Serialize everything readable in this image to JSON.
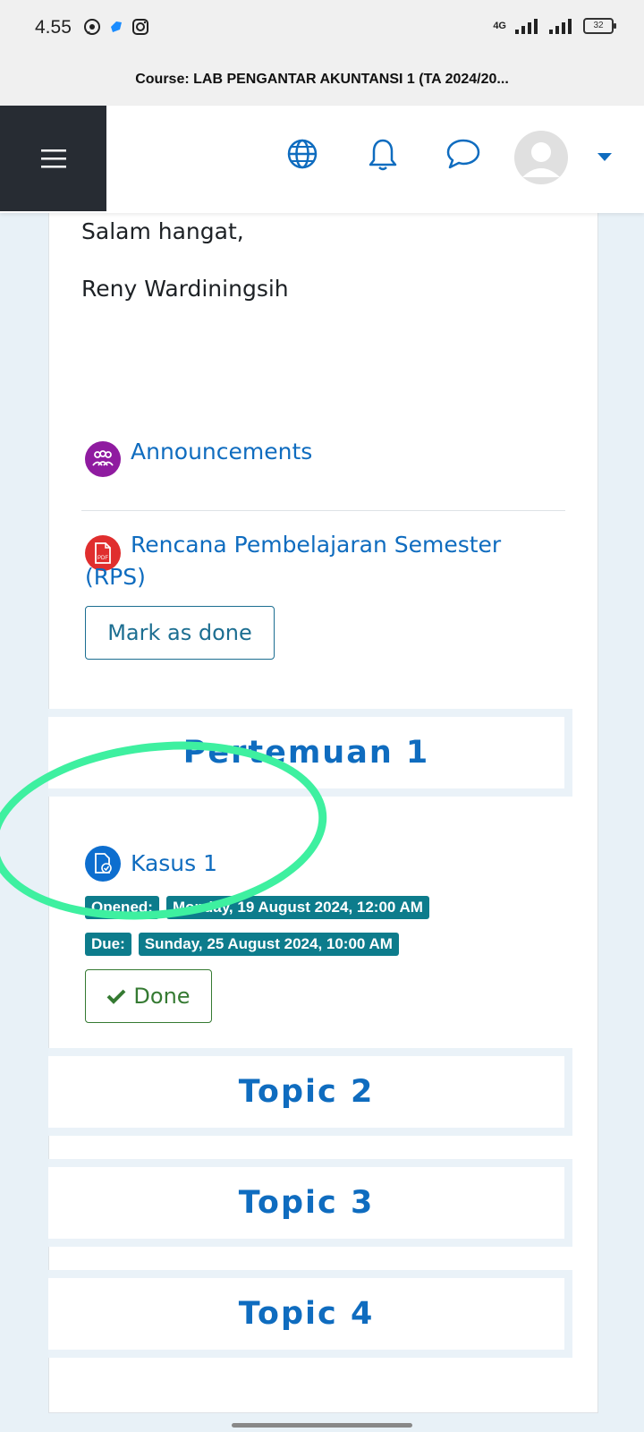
{
  "status_bar": {
    "time": "4.55",
    "battery": "32",
    "network": "4G"
  },
  "page": {
    "course_title": "Course: LAB PENGANTAR AKUNTANSI 1 (TA 2024/20..."
  },
  "content": {
    "greeting": "Salam hangat,",
    "signature": "Reny Wardiningsih",
    "activities": [
      {
        "label": "Announcements",
        "icon": "forum-icon",
        "color": "#8f1ba0"
      },
      {
        "label_line1": "Rencana Pembelajaran Semester",
        "label_line2": "(RPS)",
        "icon": "pdf-icon",
        "color": "#e02e2e",
        "button": "Mark as done"
      }
    ]
  },
  "sections": [
    {
      "title": "Pertemuan 1",
      "activity": {
        "label": "Kasus 1",
        "icon": "assignment-icon",
        "color": "#0d6ecf",
        "opened_label": "Opened:",
        "opened_value": "Monday, 19 August 2024, 12:00 AM",
        "due_label": "Due:",
        "due_value": "Sunday, 25 August 2024, 10:00 AM",
        "button": "Done"
      }
    },
    {
      "title": "Topic 2"
    },
    {
      "title": "Topic 3"
    },
    {
      "title": "Topic 4"
    }
  ],
  "colors": {
    "nav_dark": "#272c33",
    "link": "#0f6cbf",
    "badge": "#0d7c8c",
    "done": "#357a32",
    "highlight": "#3ef0a0"
  }
}
